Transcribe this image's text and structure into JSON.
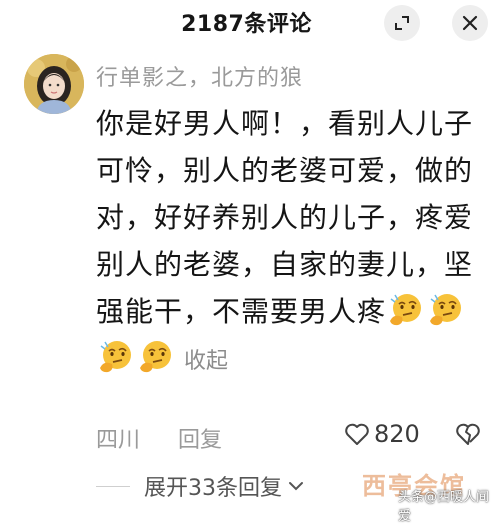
{
  "header": {
    "title": "2187条评论"
  },
  "comment": {
    "username": "行单影之，北方的狼",
    "text": "你是好男人啊！，看别人儿子可怜，别人的老婆可爱，做的对，好好养别人的儿子，疼爱别人的老婆，自家的妻儿，坚强能干，不需要男人疼",
    "emoji_icon": "thinking-face-emoji",
    "emoji_count": 4,
    "collapse_label": "收起",
    "location": "四川",
    "reply_label": "回复",
    "like_count": "820"
  },
  "replies": {
    "expand_label": "展开33条回复"
  },
  "watermark": {
    "logo": "西亭会馆",
    "text": "头条@西暖人间爱"
  },
  "colors": {
    "secondary_text": "#9a9a9a",
    "watermark": "#e8a77a"
  }
}
